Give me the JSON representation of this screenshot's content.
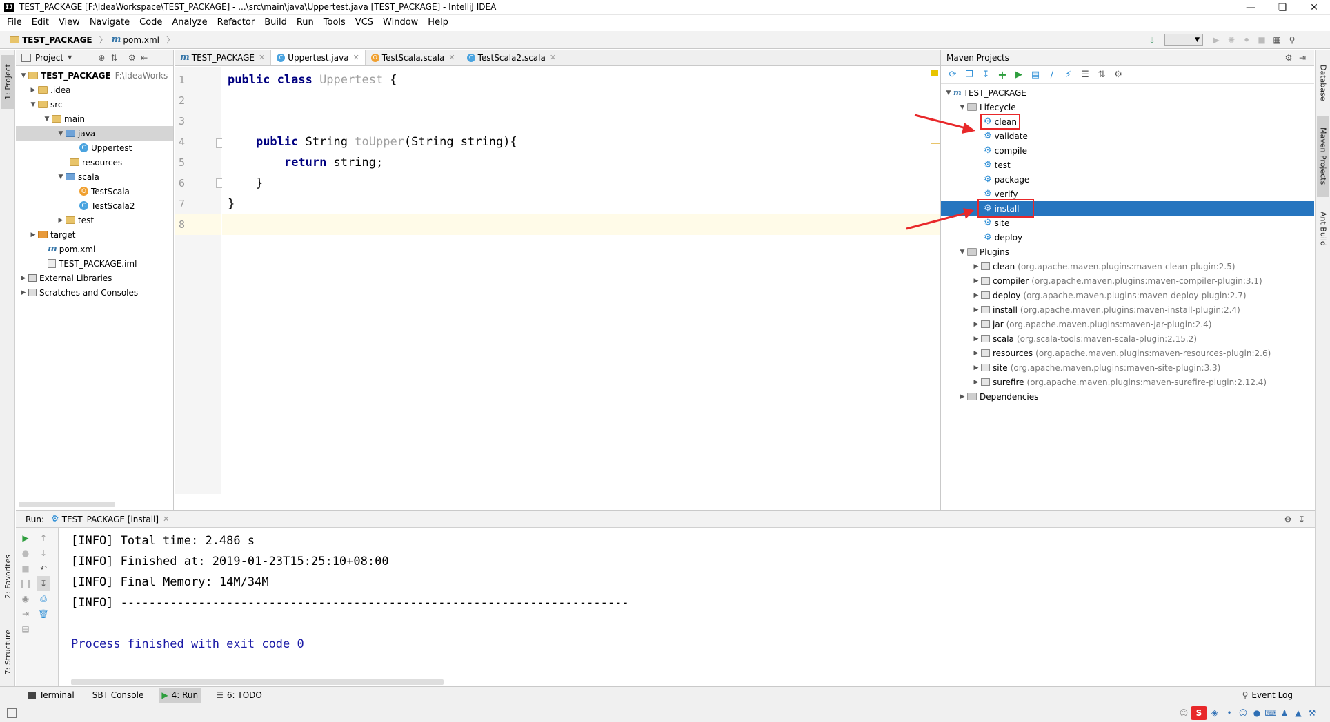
{
  "window": {
    "title": "TEST_PACKAGE [F:\\IdeaWorkspace\\TEST_PACKAGE] - ...\\src\\main\\java\\Uppertest.java [TEST_PACKAGE] - IntelliJ IDEA",
    "logo": "IJ"
  },
  "menu": [
    "File",
    "Edit",
    "View",
    "Navigate",
    "Code",
    "Analyze",
    "Refactor",
    "Build",
    "Run",
    "Tools",
    "VCS",
    "Window",
    "Help"
  ],
  "breadcrumb": {
    "project": "TEST_PACKAGE",
    "file": "pom.xml"
  },
  "left_strip": {
    "project": "1: Project",
    "favorites": "2: Favorites",
    "structure": "7: Structure"
  },
  "right_strip": {
    "database": "Database",
    "maven": "Maven Projects",
    "ant": "Ant Build"
  },
  "project_panel": {
    "title": "Project",
    "root": {
      "name": "TEST_PACKAGE",
      "path": "F:\\IdeaWorks"
    },
    "items": {
      "idea": ".idea",
      "src": "src",
      "main": "main",
      "java": "java",
      "uppertest": "Uppertest",
      "resources": "resources",
      "scala": "scala",
      "testscala": "TestScala",
      "testscala2": "TestScala2",
      "test": "test",
      "target": "target",
      "pom": "pom.xml",
      "iml": "TEST_PACKAGE.iml",
      "external": "External Libraries",
      "scratches": "Scratches and Consoles"
    }
  },
  "editor": {
    "tabs": [
      {
        "label": "TEST_PACKAGE",
        "active": false
      },
      {
        "label": "Uppertest.java",
        "active": true
      },
      {
        "label": "TestScala.scala",
        "active": false
      },
      {
        "label": "TestScala2.scala",
        "active": false
      }
    ],
    "line_numbers": [
      "1",
      "2",
      "3",
      "4",
      "5",
      "6",
      "7",
      "8"
    ],
    "code": {
      "l1_kw": "public class ",
      "l1_name": "Uppertest",
      "l1_rest": " {",
      "l4_kw": "public ",
      "l4_type": "String ",
      "l4_fn": "toUpper",
      "l4_rest": "(String string){",
      "l5_kw": "return ",
      "l5_rest": "string;",
      "l6": "}",
      "l7": "}"
    }
  },
  "maven_panel": {
    "title": "Maven Projects",
    "root": "TEST_PACKAGE",
    "lifecycle_label": "Lifecycle",
    "lifecycle": [
      "clean",
      "validate",
      "compile",
      "test",
      "package",
      "verify",
      "install",
      "site",
      "deploy"
    ],
    "selected_phase": "install",
    "plugins_label": "Plugins",
    "plugins": [
      {
        "name": "clean",
        "detail": "(org.apache.maven.plugins:maven-clean-plugin:2.5)"
      },
      {
        "name": "compiler",
        "detail": "(org.apache.maven.plugins:maven-compiler-plugin:3.1)"
      },
      {
        "name": "deploy",
        "detail": "(org.apache.maven.plugins:maven-deploy-plugin:2.7)"
      },
      {
        "name": "install",
        "detail": "(org.apache.maven.plugins:maven-install-plugin:2.4)"
      },
      {
        "name": "jar",
        "detail": "(org.apache.maven.plugins:maven-jar-plugin:2.4)"
      },
      {
        "name": "scala",
        "detail": "(org.scala-tools:maven-scala-plugin:2.15.2)"
      },
      {
        "name": "resources",
        "detail": "(org.apache.maven.plugins:maven-resources-plugin:2.6)"
      },
      {
        "name": "site",
        "detail": "(org.apache.maven.plugins:maven-site-plugin:3.3)"
      },
      {
        "name": "surefire",
        "detail": "(org.apache.maven.plugins:maven-surefire-plugin:2.12.4)"
      }
    ],
    "dependencies_label": "Dependencies"
  },
  "run_panel": {
    "label": "Run:",
    "tab": "TEST_PACKAGE [install]",
    "output": [
      "[INFO] Total time: 2.486 s",
      "[INFO] Finished at: 2019-01-23T15:25:10+08:00",
      "[INFO] Final Memory: 14M/34M",
      "[INFO] ------------------------------------------------------------------------",
      "",
      "Process finished with exit code 0"
    ]
  },
  "bottom_bar": {
    "terminal": "Terminal",
    "sbt": "SBT Console",
    "run": "4: Run",
    "todo": "6: TODO",
    "event_log": "Event Log"
  },
  "colors": {
    "selection_blue": "#2675bf",
    "annotation_red": "#e8282a",
    "keyword": "#000080",
    "process_text": "#1a1aa6"
  }
}
